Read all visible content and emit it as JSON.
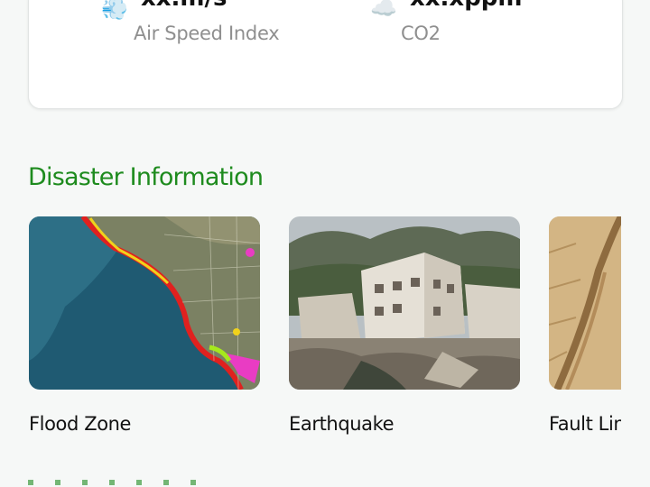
{
  "stats": [
    {
      "icon": "wind-icon",
      "glyph": "💨",
      "value": "xx.m/s",
      "label": "Air Speed Index"
    },
    {
      "icon": "cloud-icon",
      "glyph": "☁️",
      "value": "xx.xppm",
      "label": "CO2"
    }
  ],
  "section": {
    "title": "Disaster Information"
  },
  "disasters": [
    {
      "caption": "Flood Zone",
      "image": "flood-map-image"
    },
    {
      "caption": "Earthquake",
      "image": "earthquake-damage-image"
    },
    {
      "caption": "Fault Line",
      "image": "fault-line-image"
    }
  ],
  "colors": {
    "accent": "#1e8b1e",
    "muted_text": "#8f8f8f",
    "background": "#f6f8f7"
  }
}
